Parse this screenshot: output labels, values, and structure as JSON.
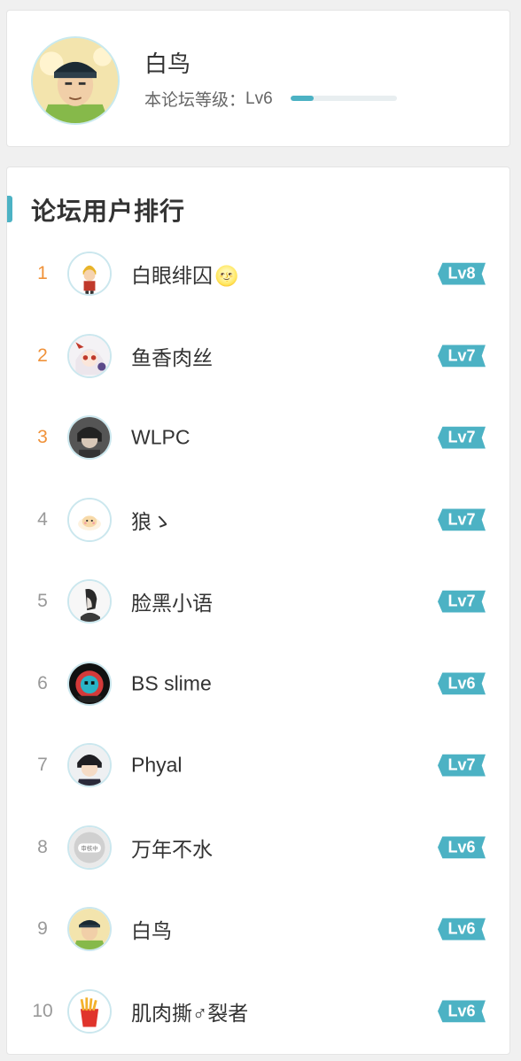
{
  "profile": {
    "name": "白鸟",
    "level_label": "本论坛等级：",
    "level": "Lv6",
    "level_progress": 0.22,
    "avatar_icon": "anime-character-avatar"
  },
  "ranking": {
    "title": "论坛用户排行",
    "users": [
      {
        "rank": "1",
        "name": "白眼绯囚",
        "emoji": "🌝",
        "level": "Lv8",
        "avatar_icon": "cartoon-boy-avatar"
      },
      {
        "rank": "2",
        "name": "鱼香肉丝",
        "emoji": "",
        "level": "Lv7",
        "avatar_icon": "anime-girl-avatar"
      },
      {
        "rank": "3",
        "name": "WLPC",
        "emoji": "",
        "level": "Lv7",
        "avatar_icon": "dark-hair-avatar"
      },
      {
        "rank": "4",
        "name": "狼ゝ",
        "emoji": "",
        "level": "Lv7",
        "avatar_icon": "cute-cat-avatar"
      },
      {
        "rank": "5",
        "name": "脸黑小语",
        "emoji": "",
        "level": "Lv7",
        "avatar_icon": "sketch-portrait-avatar"
      },
      {
        "rank": "6",
        "name": "BS slime",
        "emoji": "",
        "level": "Lv6",
        "avatar_icon": "red-blue-avatar"
      },
      {
        "rank": "7",
        "name": "Phyal",
        "emoji": "",
        "level": "Lv7",
        "avatar_icon": "anime-boy-avatar"
      },
      {
        "rank": "8",
        "name": "万年不水",
        "emoji": "",
        "level": "Lv6",
        "avatar_icon": "under-review-avatar",
        "avatar_text": "审核中"
      },
      {
        "rank": "9",
        "name": "白鸟",
        "emoji": "",
        "level": "Lv6",
        "avatar_icon": "anime-character-avatar"
      },
      {
        "rank": "10",
        "name": "肌肉撕♂裂者",
        "emoji": "",
        "level": "Lv6",
        "avatar_icon": "fries-avatar"
      }
    ]
  },
  "colors": {
    "accent": "#4cb2c4",
    "top_rank": "#f0923a",
    "rank": "#999999"
  }
}
